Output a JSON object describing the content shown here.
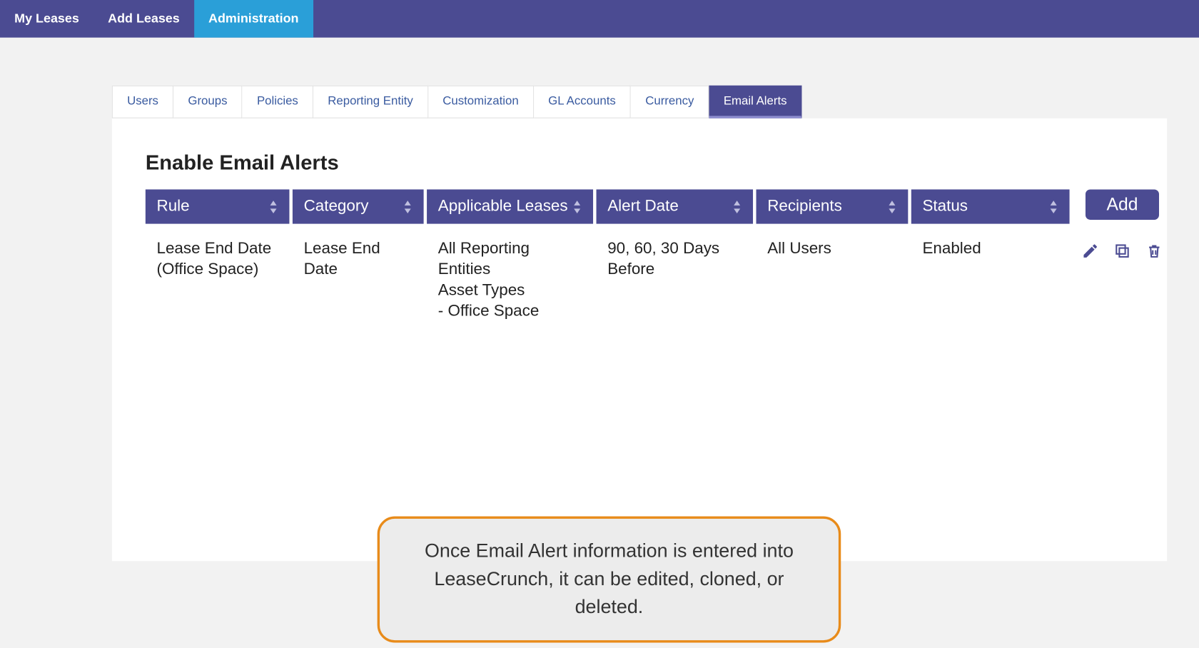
{
  "topnav": {
    "items": [
      {
        "label": "My Leases",
        "active": false
      },
      {
        "label": "Add Leases",
        "active": false
      },
      {
        "label": "Administration",
        "active": true
      }
    ]
  },
  "tabs": [
    {
      "label": "Users",
      "active": false
    },
    {
      "label": "Groups",
      "active": false
    },
    {
      "label": "Policies",
      "active": false
    },
    {
      "label": "Reporting Entity",
      "active": false
    },
    {
      "label": "Customization",
      "active": false
    },
    {
      "label": "GL Accounts",
      "active": false
    },
    {
      "label": "Currency",
      "active": false
    },
    {
      "label": "Email Alerts",
      "active": true
    }
  ],
  "panel": {
    "title": "Enable Email Alerts",
    "columns": [
      "Rule",
      "Category",
      "Applicable Leases",
      "Alert Date",
      "Recipients",
      "Status"
    ],
    "add_label": "Add",
    "rows": [
      {
        "rule": "Lease End Date (Office Space)",
        "category": "Lease End Date",
        "applicable": "All Reporting Entities\nAsset Types\n- Office Space",
        "alert_date": "90, 60, 30 Days Before",
        "recipients": "All Users",
        "status": "Enabled"
      }
    ]
  },
  "callout": {
    "text": "Once Email Alert information is entered into LeaseCrunch, it can be edited, cloned, or deleted."
  }
}
